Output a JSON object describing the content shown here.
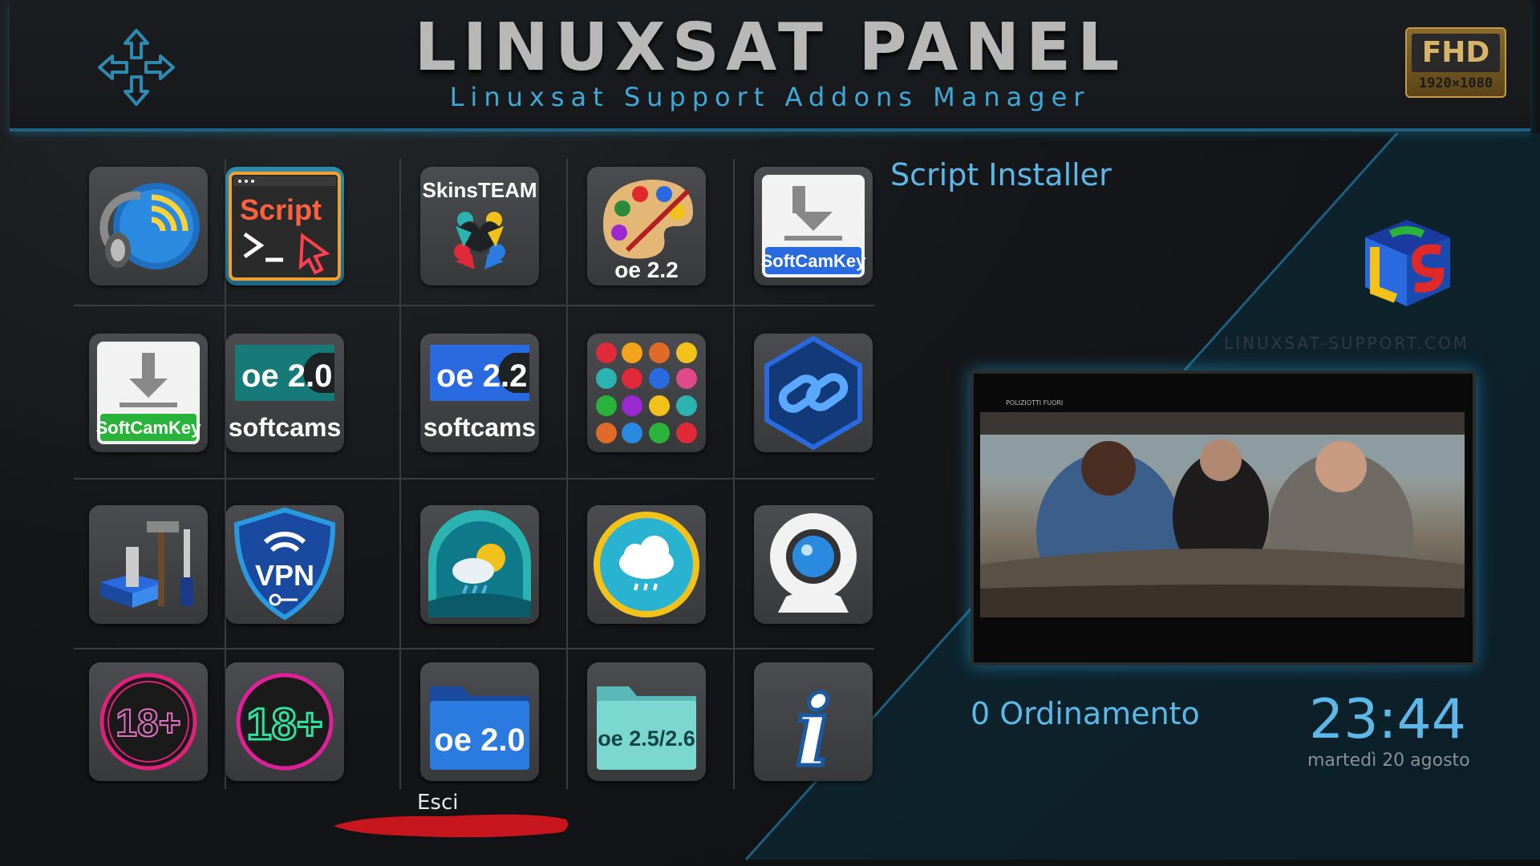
{
  "header": {
    "title": "LINUXSAT PANEL",
    "subtitle": "Linuxsat Support Addons Manager",
    "badge_top": "FHD",
    "badge_bottom": "1920×1080"
  },
  "tiles": [
    {
      "name": "audio-addon",
      "label": ""
    },
    {
      "name": "script",
      "label": "Script"
    },
    {
      "name": "skinsteam",
      "label": "SkinsTEAM"
    },
    {
      "name": "oe22-skins",
      "label": "oe 2.2"
    },
    {
      "name": "softcamkey-blue",
      "label": "SoftCamKey"
    },
    {
      "name": "softcamkey-green",
      "label": "SoftCamKey"
    },
    {
      "name": "oe20-softcams",
      "label": "oe 2.0",
      "label2": "softcams"
    },
    {
      "name": "oe22-softcams",
      "label": "oe 2.2",
      "label2": "softcams"
    },
    {
      "name": "apps-collection",
      "label": ""
    },
    {
      "name": "link",
      "label": ""
    },
    {
      "name": "tools",
      "label": ""
    },
    {
      "name": "vpn",
      "label": "VPN"
    },
    {
      "name": "weather-1",
      "label": ""
    },
    {
      "name": "weather-2",
      "label": ""
    },
    {
      "name": "webcam",
      "label": ""
    },
    {
      "name": "adult-1",
      "label": "18+"
    },
    {
      "name": "adult-2",
      "label": "18+"
    },
    {
      "name": "oe20-folder",
      "label": "oe 2.0"
    },
    {
      "name": "oe25-folder",
      "label": "oe 2.5/2.6"
    },
    {
      "name": "info",
      "label": "i"
    }
  ],
  "exit_label": "Esci",
  "selected_title": "Script Installer",
  "site": "LINUXSAT-SUPPORT.COM",
  "preview_caption": "POLIZIOTTI FUORI",
  "sort_label": "0 Ordinamento",
  "clock": "23:44",
  "date": "martedì 20 agosto",
  "colors": {
    "accent": "#5bb8e8",
    "exit_bar": "#c8161e",
    "selected": "#2f8aa8"
  }
}
